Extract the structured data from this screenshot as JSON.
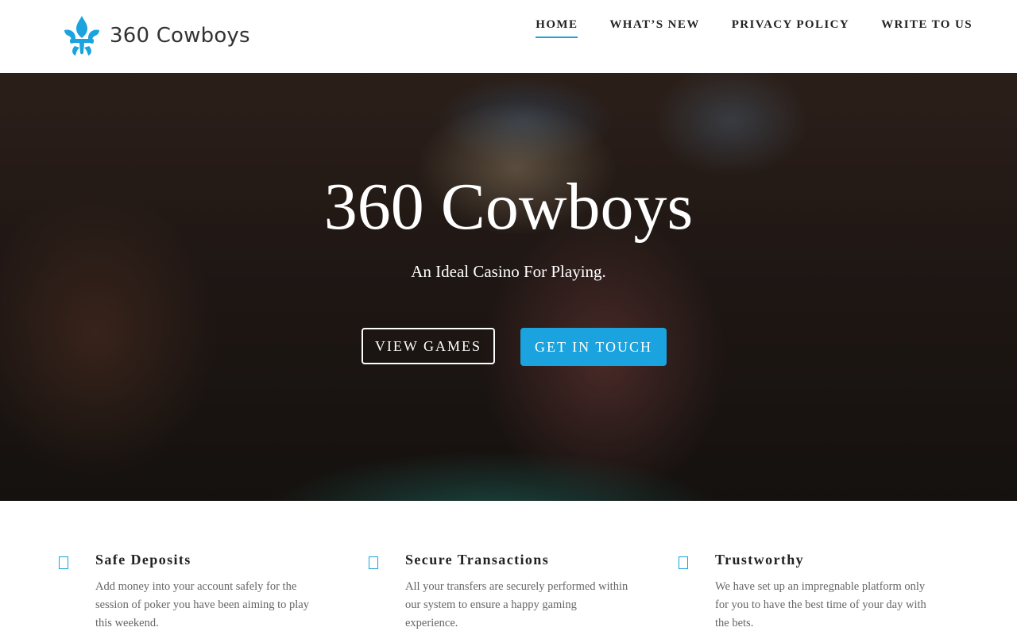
{
  "header": {
    "logo_text": "360 Cowboys",
    "nav": [
      {
        "label": "HOME",
        "active": true
      },
      {
        "label": "WHAT’S NEW",
        "active": false
      },
      {
        "label": "PRIVACY POLICY",
        "active": false
      },
      {
        "label": "WRITE TO US",
        "active": false
      }
    ]
  },
  "hero": {
    "title": "360 Cowboys",
    "subtitle": "An Ideal Casino For Playing.",
    "buttons": {
      "view_games": "VIEW GAMES",
      "get_in_touch": "GET IN TOUCH"
    }
  },
  "features": [
    {
      "icon": "square-icon",
      "title": "Safe Deposits",
      "text": "Add money into your account safely for the session of poker you have been aiming to play this weekend."
    },
    {
      "icon": "square-icon",
      "title": "Secure Transactions",
      "text": "All your transfers are securely performed within our system to ensure a happy gaming experience."
    },
    {
      "icon": "square-icon",
      "title": "Trustworthy",
      "text": "We have set up an impregnable platform only for you to have the best time of your day with the bets."
    }
  ],
  "colors": {
    "accent": "#1aa3de",
    "nav_text": "#222222"
  }
}
